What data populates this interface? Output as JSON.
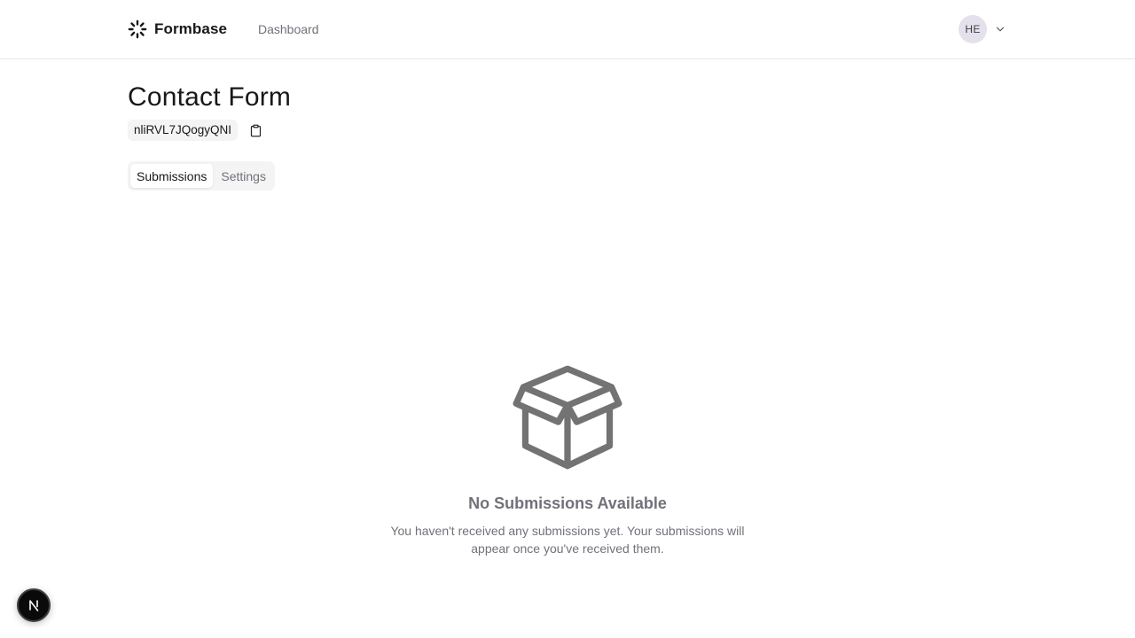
{
  "header": {
    "brand_name": "Formbase",
    "brand_icon": "loader-icon",
    "nav": {
      "dashboard_label": "Dashboard"
    },
    "user": {
      "initials": "HE",
      "menu_icon": "chevron-down-icon"
    }
  },
  "form": {
    "title": "Contact Form",
    "id": "nliRVL7JQogyQNI",
    "copy_icon": "clipboard-icon"
  },
  "tabs": [
    {
      "label": "Submissions",
      "active": true
    },
    {
      "label": "Settings",
      "active": false
    }
  ],
  "empty_state": {
    "icon": "box-icon",
    "title": "No Submissions Available",
    "description": "You haven't received any submissions yet. Your submissions will appear once you've received them."
  },
  "floating_badge": {
    "icon": "nextjs-icon",
    "letter": "N"
  },
  "colors": {
    "text_primary": "#18181b",
    "text_muted": "#71717a",
    "avatar_bg": "#e4e1ec",
    "pill_bg": "#f4f4f5",
    "icon_gray": "#737373"
  }
}
